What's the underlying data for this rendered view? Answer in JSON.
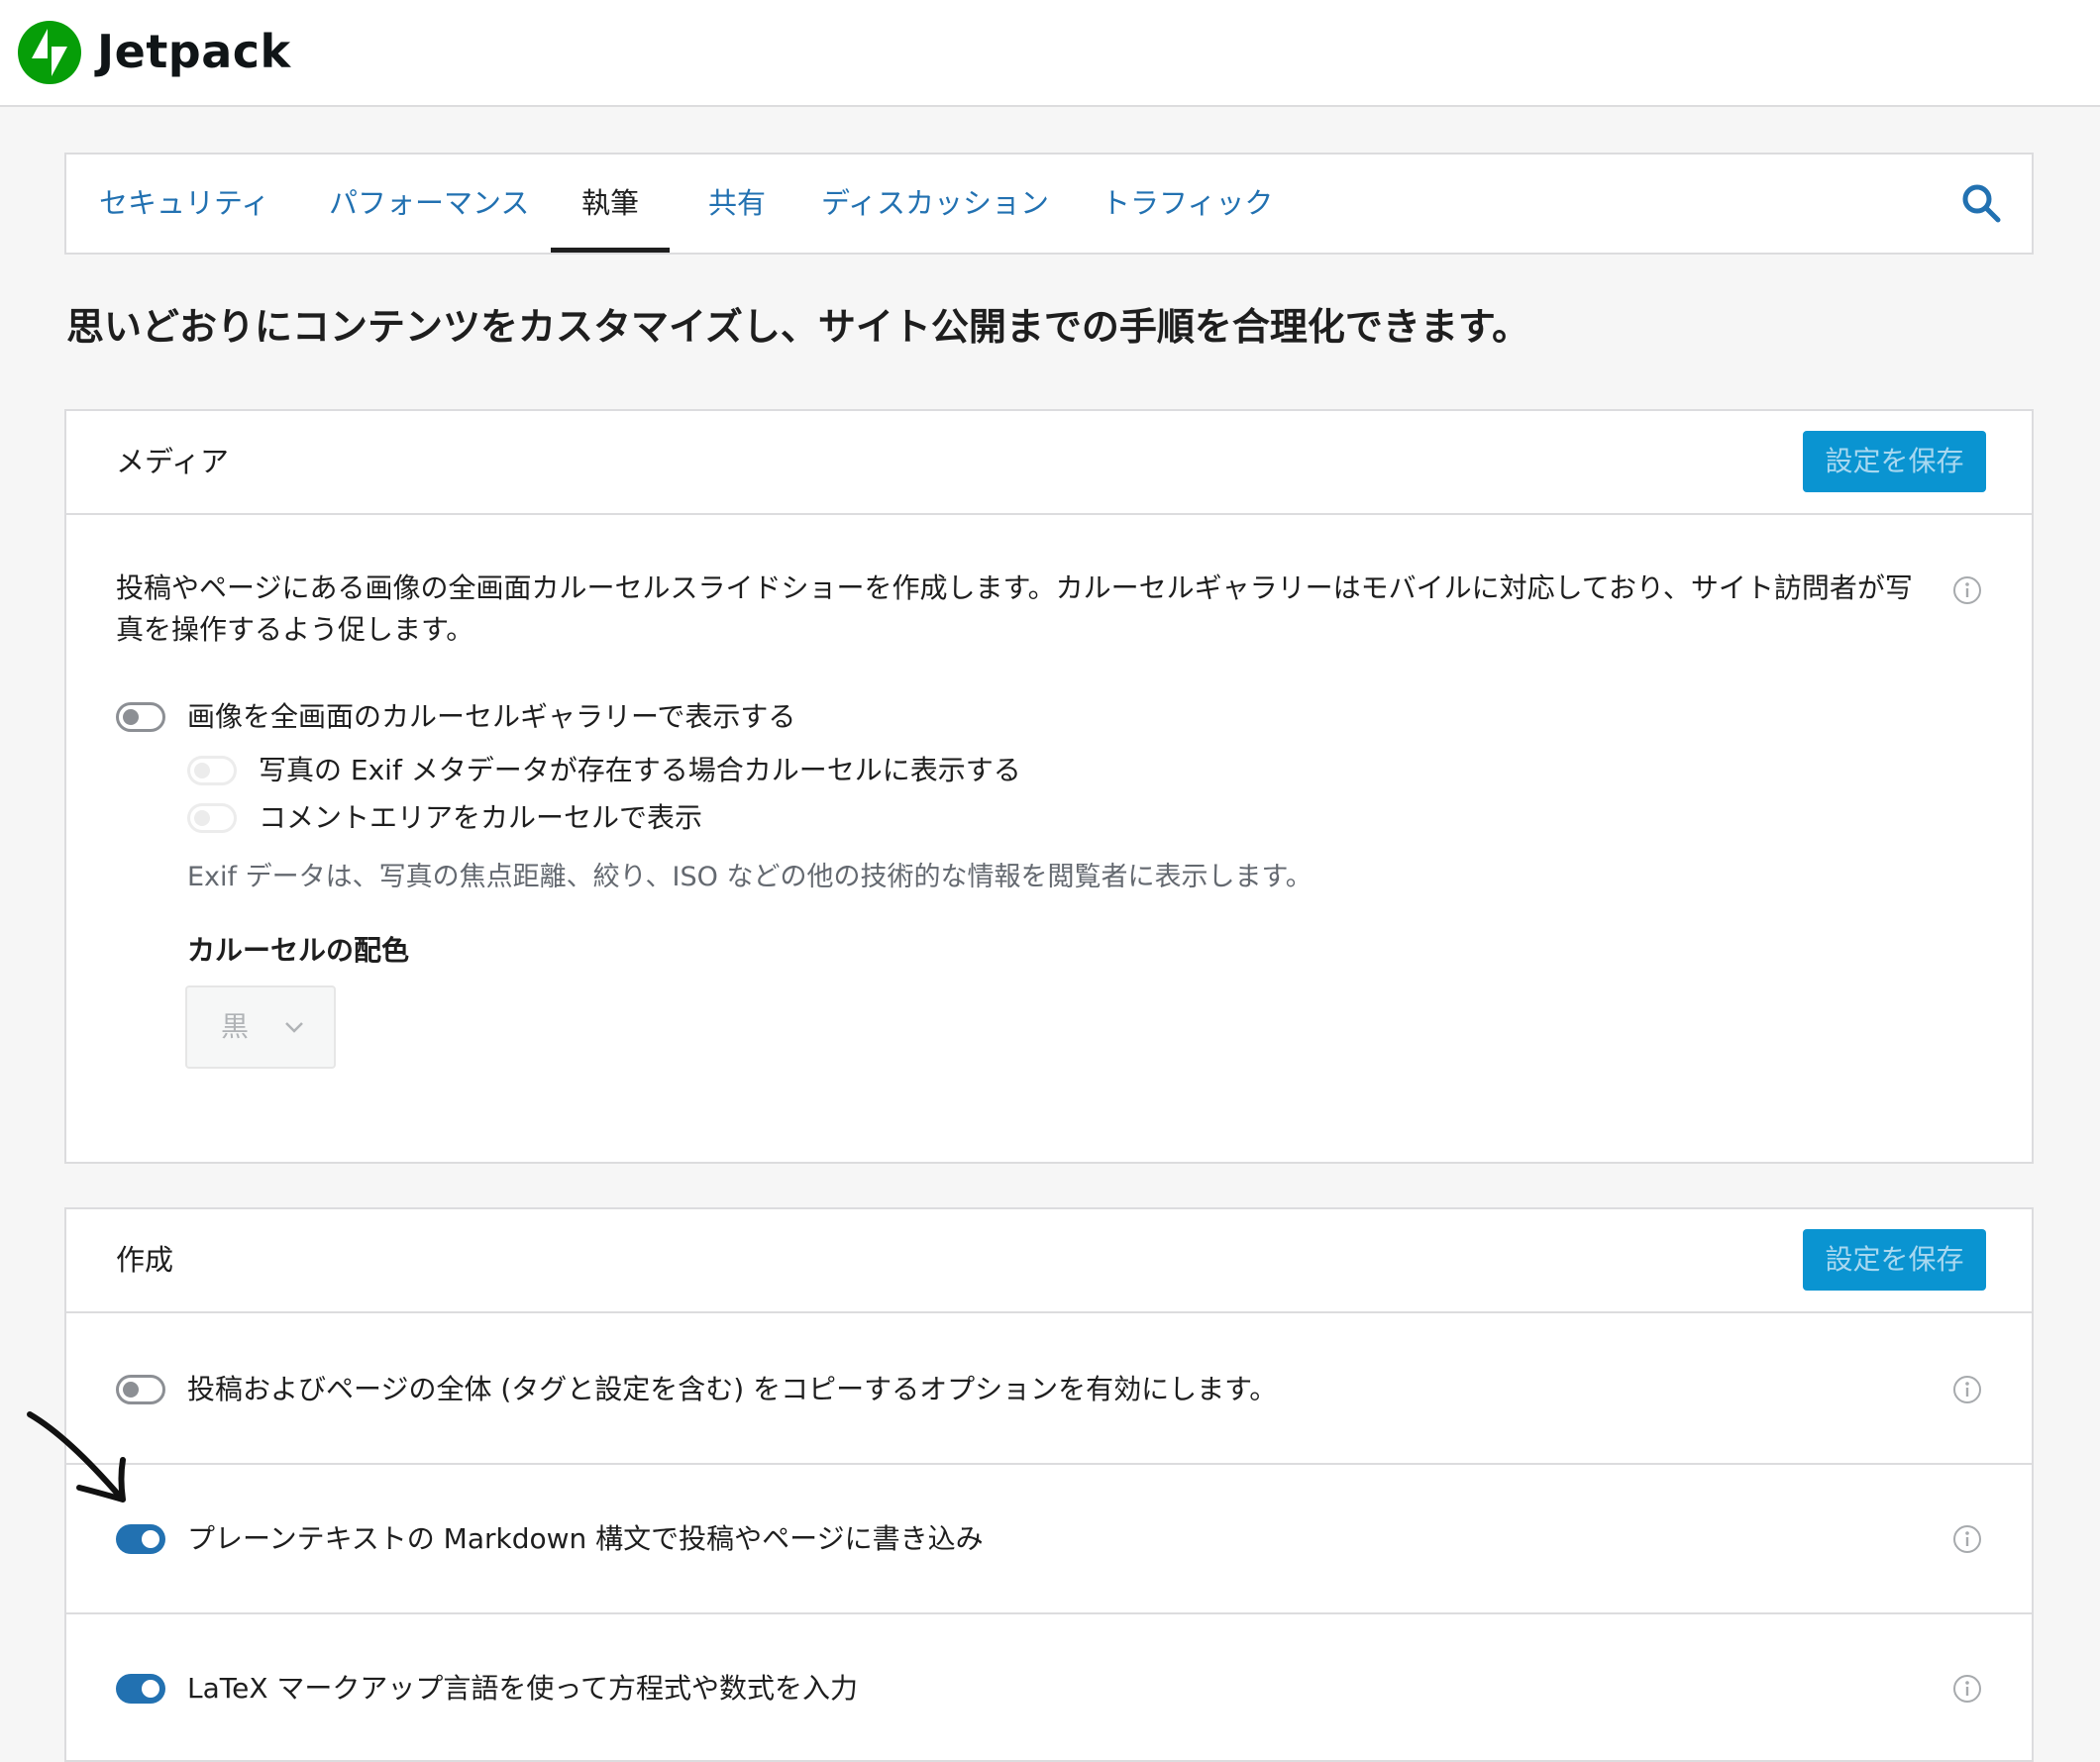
{
  "app": {
    "name": "Jetpack",
    "brand_color": "#069e08",
    "link_color": "#2271b1",
    "button_color": "#0a94d1"
  },
  "nav": {
    "tabs": [
      {
        "label": "セキュリティ",
        "active": false
      },
      {
        "label": "パフォーマンス",
        "active": false
      },
      {
        "label": "執筆",
        "active": true
      },
      {
        "label": "共有",
        "active": false
      },
      {
        "label": "ディスカッション",
        "active": false
      },
      {
        "label": "トラフィック",
        "active": false
      }
    ],
    "search_icon": "search-icon"
  },
  "headline": "思いどおりにコンテンツをカスタマイズし、サイト公開までの手順を合理化できます。",
  "media_card": {
    "title": "メディア",
    "save_label": "設定を保存",
    "description": "投稿やページにある画像の全画面カルーセルスライドショーを作成します。カルーセルギャラリーはモバイルに対応しており、サイト訪問者が写真を操作するよう促します。",
    "carousel_toggle": {
      "label": "画像を全画面のカルーセルギャラリーで表示する",
      "checked": false
    },
    "exif_toggle": {
      "label": "写真の Exif メタデータが存在する場合カルーセルに表示する",
      "checked": false,
      "disabled": true
    },
    "comments_toggle": {
      "label": "コメントエリアをカルーセルで表示",
      "checked": false,
      "disabled": true
    },
    "exif_help": "Exif データは、写真の焦点距離、絞り、ISO などの他の技術的な情報を閲覧者に表示します。",
    "color_label": "カルーセルの配色",
    "color_select": {
      "value": "黒"
    }
  },
  "compose_card": {
    "title": "作成",
    "save_label": "設定を保存",
    "rows": [
      {
        "label": "投稿およびページの全体 (タグと設定を含む) をコピーするオプションを有効にします。",
        "checked": false
      },
      {
        "label": "プレーンテキストの Markdown 構文で投稿やページに書き込み",
        "checked": true
      },
      {
        "label": "LaTeX マークアップ言語を使って方程式や数式を入力",
        "checked": true
      }
    ]
  }
}
